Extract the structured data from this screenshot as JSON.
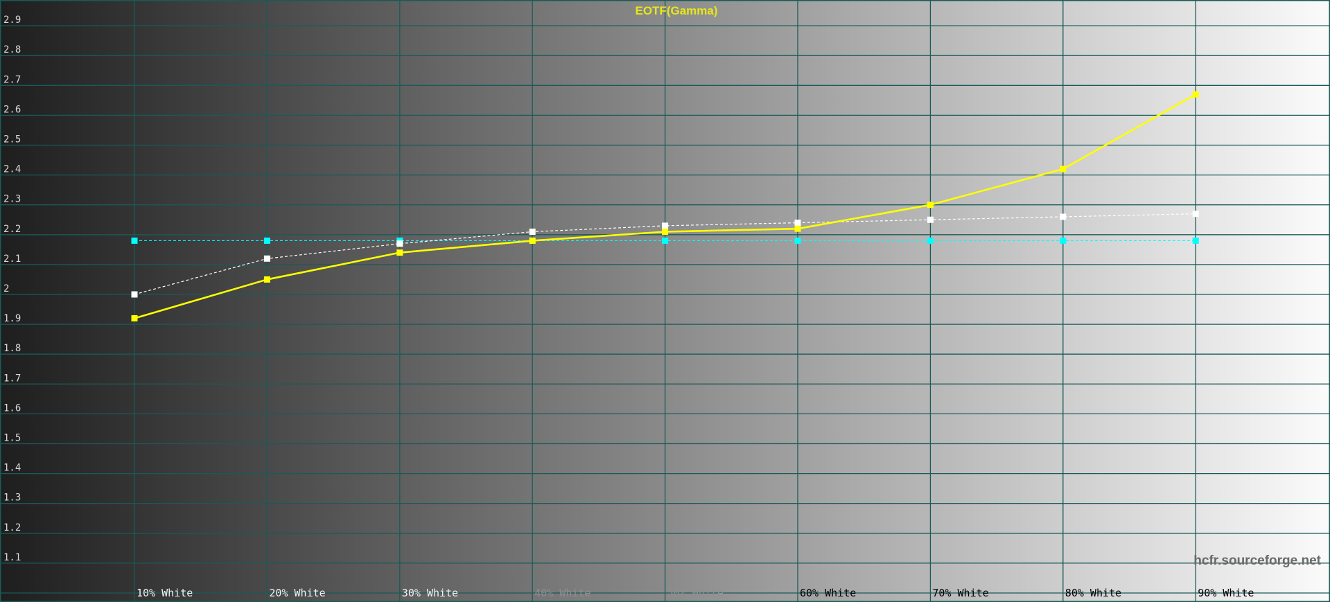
{
  "chart_data": {
    "type": "line",
    "title": "EOTF(Gamma)",
    "watermark": "hcfr.sourceforge.net",
    "categories": [
      "10% White",
      "20% White",
      "30% White",
      "40% White",
      "50% White",
      "60% White",
      "70% White",
      "80% White",
      "90% White"
    ],
    "y_ticks": [
      "1.1",
      "1.2",
      "1.3",
      "1.4",
      "1.5",
      "1.6",
      "1.7",
      "1.8",
      "1.9",
      "2",
      "2.1",
      "2.2",
      "2.3",
      "2.4",
      "2.5",
      "2.6",
      "2.7",
      "2.8",
      "2.9"
    ],
    "ylim": [
      1.0,
      3.0
    ],
    "grid": true,
    "series": [
      {
        "values": [
          1.92,
          2.05,
          2.14,
          2.18,
          2.21,
          2.22,
          2.3,
          2.42,
          2.67
        ],
        "color": "#ffff00",
        "style": "solid"
      },
      {
        "values": [
          2.0,
          2.12,
          2.17,
          2.21,
          2.23,
          2.24,
          2.25,
          2.26,
          2.27
        ],
        "color": "#ffffff",
        "style": "dashed"
      },
      {
        "values": [
          2.18,
          2.18,
          2.18,
          2.18,
          2.18,
          2.18,
          2.18,
          2.18,
          2.18
        ],
        "color": "#00ffff",
        "style": "dashed"
      }
    ],
    "colors": {
      "grid": "#1b5a58",
      "title": "#e6e61a",
      "watermark": "#6a6a6a",
      "x_label_dark": "#f2f2f2",
      "x_label_light": "#000000"
    }
  }
}
